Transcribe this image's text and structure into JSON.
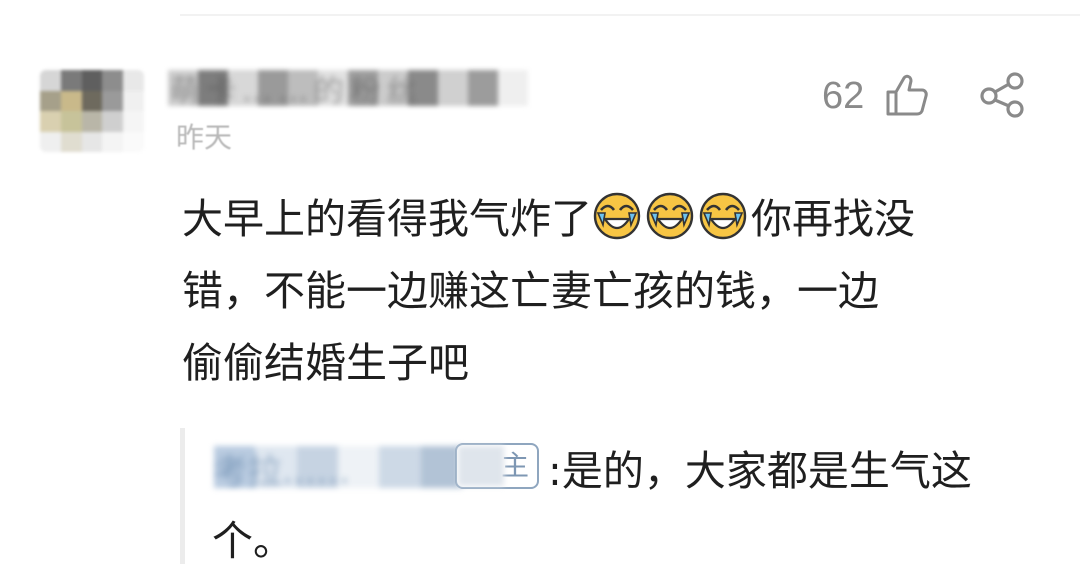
{
  "comment": {
    "username": "萌卡……的粉丝",
    "timestamp": "昨天",
    "like_count": "62",
    "text_line1": "大早上的看得我气炸了",
    "text_line1_tail": "你再找没",
    "text_line2": "错，不能一边赚这亡妻亡孩的钱，一边",
    "text_line3": "偷偷结婚生子吧",
    "emojis": [
      "laugh-cry-emoji",
      "laugh-cry-emoji",
      "laugh-cry-emoji"
    ]
  },
  "reply": {
    "author": "考拉……",
    "badge": "主",
    "separator": ":",
    "text_line1": "是的，大家都是生气这",
    "text_line2": "个。"
  },
  "icons": {
    "like": "thumbs-up-icon",
    "share": "share-icon"
  },
  "colors": {
    "text": "#1f1f1f",
    "meta": "#8a8a8a",
    "badge": "#8fa6bf",
    "emoji_face": "#f7c544"
  }
}
